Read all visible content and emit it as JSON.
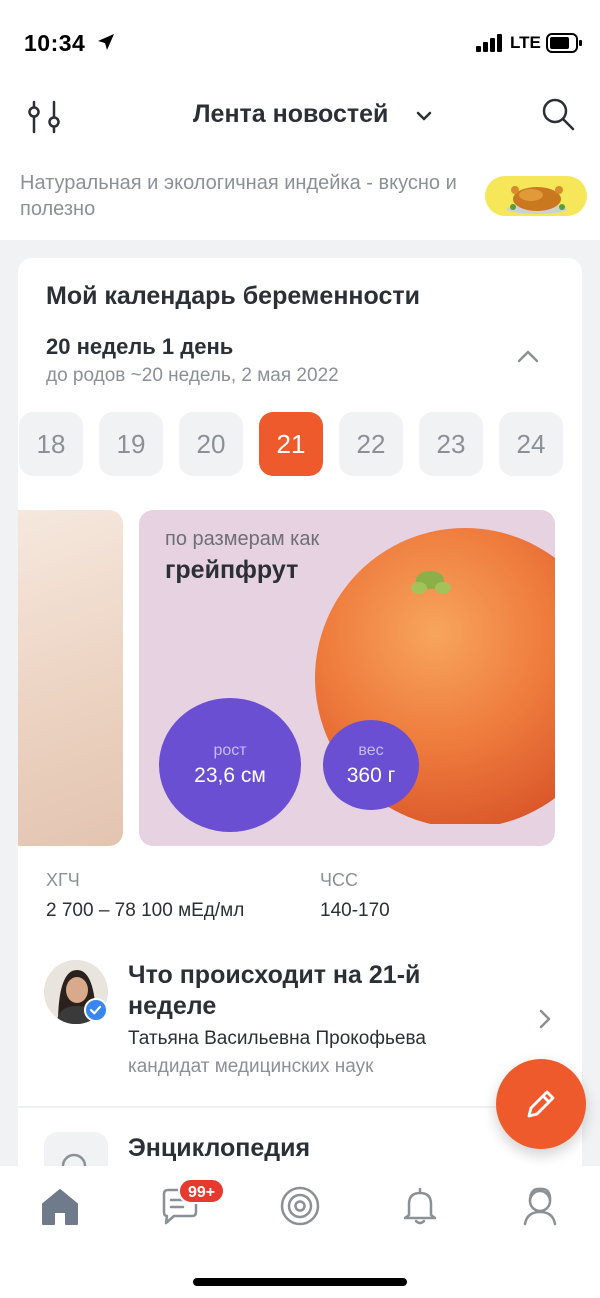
{
  "status_bar": {
    "time": "10:34",
    "network": "LTE"
  },
  "header": {
    "title": "Лента новостей",
    "icons": [
      "filter-icon",
      "chevron-down-icon",
      "search-icon"
    ]
  },
  "ad": {
    "text": "Натуральная и экологичная индейка - вкусно и полезно"
  },
  "pregnancy_card": {
    "title": "Мой календарь беременности",
    "current": "20 недель 1 день",
    "due": "до родов ~20 недель, 2 мая 2022",
    "weeks": [
      "18",
      "19",
      "20",
      "21",
      "22",
      "23",
      "24"
    ],
    "active_week": "21",
    "size": {
      "caption": "по размерам как",
      "fruit": "грейпфрут"
    },
    "height": {
      "label": "рост",
      "value": "23,6 см"
    },
    "weight": {
      "label": "вес",
      "value": "360 г"
    },
    "stats": [
      {
        "label": "ХГЧ",
        "value": "2 700 – 78 100 мЕд/мл"
      },
      {
        "label": "ЧСС",
        "value": "140-170"
      }
    ],
    "article": {
      "title": "Что происходит на 21-й неделе",
      "author": "Татьяна Васильевна Прокофьева",
      "degree": "кандидат медицинских наук"
    },
    "encyclopedia": "Энциклопедия"
  },
  "tabbar": {
    "tabs": [
      "home-icon",
      "chat-icon",
      "target-icon",
      "bell-icon",
      "profile-icon"
    ],
    "chat_badge": "99+"
  },
  "colors": {
    "accent": "#ee5a2b",
    "bubble": "#6a4fd3",
    "slide_bg": "#e7d2e2"
  }
}
